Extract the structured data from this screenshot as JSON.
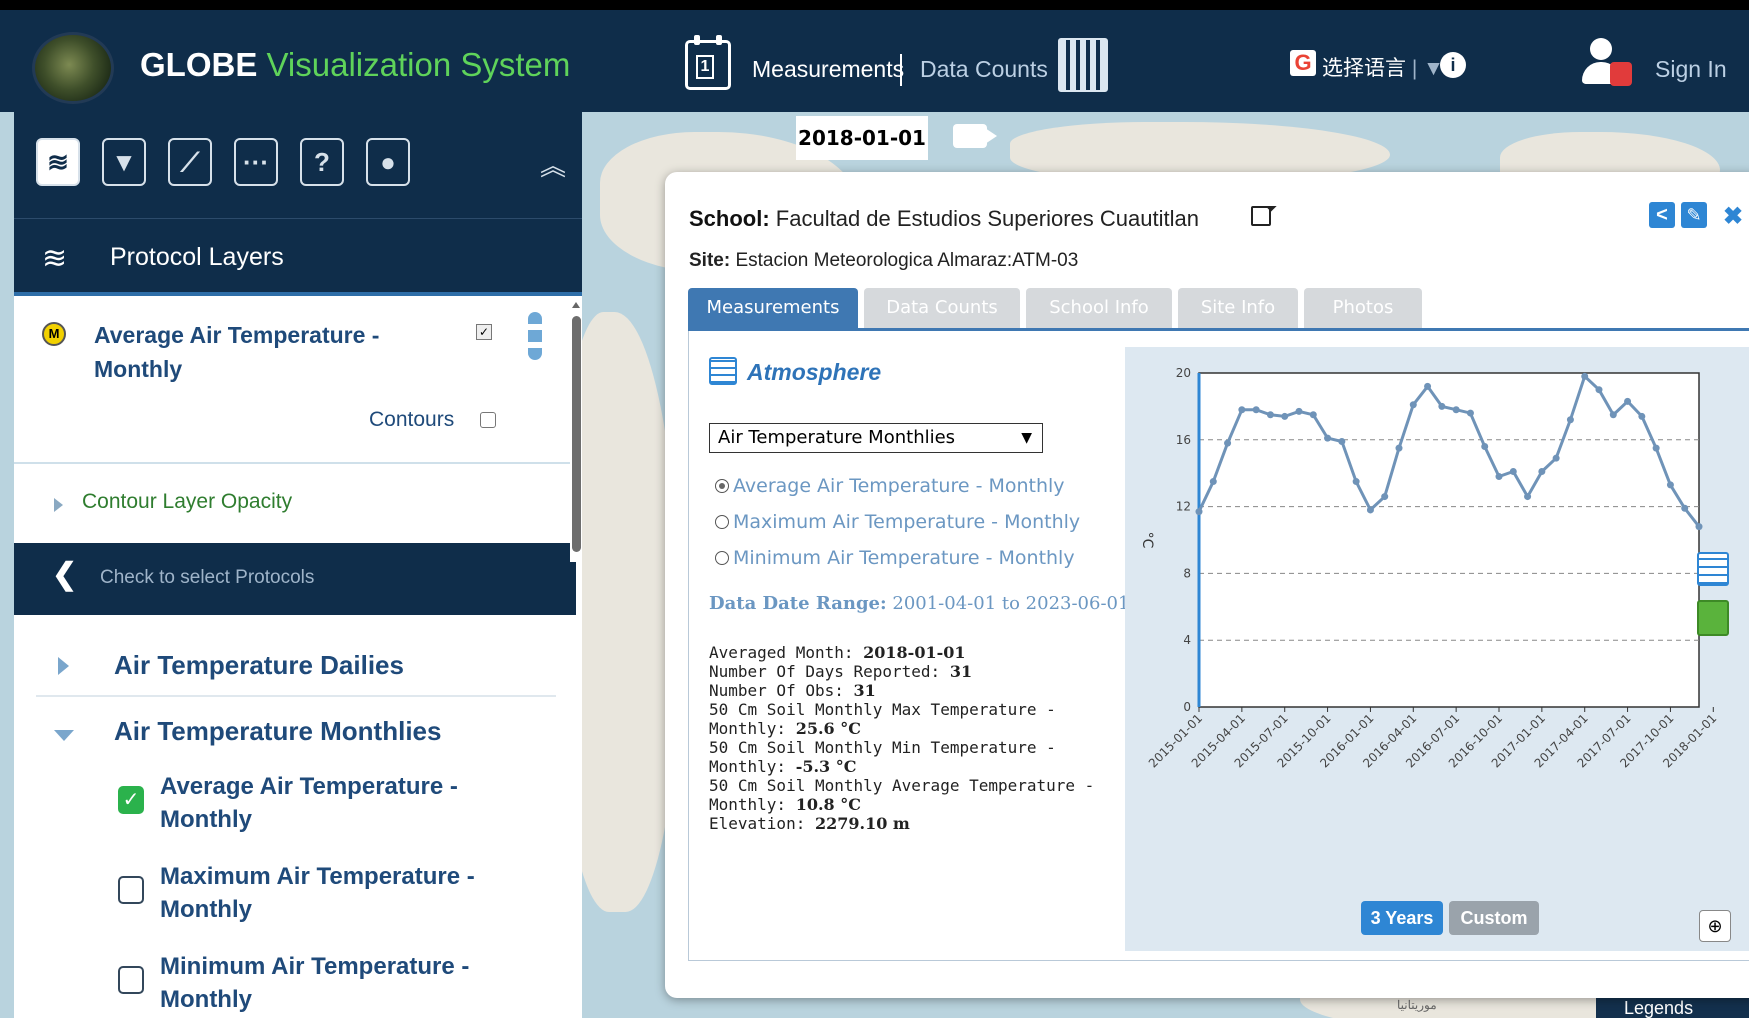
{
  "app": {
    "name_part1": "GLOBE",
    "name_part2": "Visualization System"
  },
  "topbar": {
    "calendar_icon_text": "1",
    "measurements": "Measurements",
    "data_counts": "Data Counts",
    "language": "选择语言",
    "language_arrow": "| ▼",
    "info": "i",
    "sign_in": "Sign In"
  },
  "sidebar": {
    "layers_title": "Protocol Layers",
    "layer": {
      "badge": "M",
      "name": "Average Air Temperature - Monthly",
      "checked": true,
      "contours_label": "Contours",
      "contours_checked": false
    },
    "contour_opacity_label": "Contour Layer Opacity",
    "protocols_label": "Check to select Protocols",
    "groups": [
      {
        "label": "Air Temperature Dailies",
        "expanded": false
      },
      {
        "label": "Air Temperature Monthlies",
        "expanded": true
      }
    ],
    "items": [
      {
        "label": "Average Air Temperature - Monthly",
        "checked": true
      },
      {
        "label": "Maximum Air Temperature - Monthly",
        "checked": false
      },
      {
        "label": "Minimum Air Temperature - Monthly",
        "checked": false
      }
    ]
  },
  "map": {
    "date": "2018-01-01",
    "legends": "Legends",
    "place_label": "موريتانيا"
  },
  "popup": {
    "school_label": "School:",
    "school_name": "Facultad de Estudios Superiores Cuautitlan",
    "site_label": "Site:",
    "site_name": "Estacion Meteorologica Almaraz:ATM-03",
    "tabs": [
      "Measurements",
      "Data Counts",
      "School Info",
      "Site Info",
      "Photos"
    ],
    "active_tab": "Measurements",
    "section_title": "Atmosphere",
    "select_value": "Air Temperature Monthlies",
    "radios": [
      {
        "label": "Average Air Temperature - Monthly",
        "selected": true
      },
      {
        "label": "Maximum Air Temperature - Monthly",
        "selected": false
      },
      {
        "label": "Minimum Air Temperature - Monthly",
        "selected": false
      }
    ],
    "date_range_label": "Data Date Range:",
    "date_range_value": "2001-04-01 to 2023-06-01",
    "details": {
      "averaged_month_label": "Averaged Month:",
      "averaged_month": "2018-01-01",
      "days_reported_label": "Number Of Days Reported:",
      "days_reported": "31",
      "obs_label": "Number Of Obs:",
      "obs": "31",
      "max_label_1": "50 Cm Soil Monthly Max Temperature -",
      "max_label_2": "Monthly:",
      "max_value": "25.6 °C",
      "min_label_1": "50 Cm Soil Monthly Min Temperature -",
      "min_label_2": "Monthly:",
      "min_value": "-5.3 °C",
      "avg_label_1": "50 Cm Soil Monthly Average Temperature -",
      "avg_label_2": "Monthly:",
      "avg_value": "10.8 °C",
      "elevation_label": "Elevation:",
      "elevation": "2279.10 m"
    },
    "range_buttons": [
      "3 Years",
      "Custom"
    ],
    "active_range": "3 Years"
  },
  "colors": {
    "navy": "#0f2d4a",
    "accent_green": "#5fd35a",
    "tab_blue": "#3f78b2",
    "series": "#6f93b8"
  },
  "chart_data": {
    "type": "line",
    "ylabel": "°C",
    "ylim": [
      0,
      20
    ],
    "yticks": [
      0,
      4,
      8,
      12,
      16,
      20
    ],
    "grid": "dashed horizontal",
    "x_tick_labels": [
      "2015-01-01",
      "2015-04-01",
      "2015-07-01",
      "2015-10-01",
      "2016-01-01",
      "2016-04-01",
      "2016-07-01",
      "2016-10-01",
      "2017-01-01",
      "2017-04-01",
      "2017-07-01",
      "2017-10-01",
      "2018-01-01"
    ],
    "series": [
      {
        "values": [
          11.7,
          13.5,
          15.8,
          17.8,
          17.8,
          17.5,
          17.4,
          17.7,
          17.5,
          16.1,
          15.9,
          13.5,
          11.8,
          12.6,
          15.5,
          18.1,
          19.2,
          18.0,
          17.8,
          17.6,
          15.6,
          13.8,
          14.1,
          12.6,
          14.1,
          14.9,
          17.2,
          19.8,
          19.0,
          17.5,
          18.3,
          17.4,
          15.5,
          13.3,
          11.9,
          10.8
        ]
      }
    ]
  }
}
